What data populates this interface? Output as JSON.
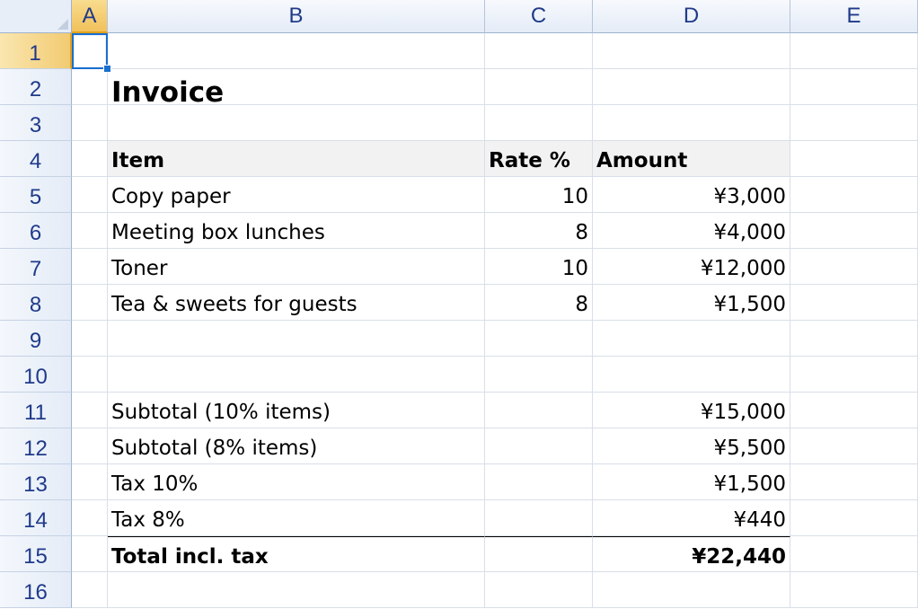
{
  "columns": [
    "A",
    "B",
    "C",
    "D",
    "E"
  ],
  "rows": [
    "1",
    "2",
    "3",
    "4",
    "5",
    "6",
    "7",
    "8",
    "9",
    "10",
    "11",
    "12",
    "13",
    "14",
    "15",
    "16"
  ],
  "invoice": {
    "title": "Invoice",
    "header": {
      "item": "Item",
      "rate": "Rate %",
      "amount": "Amount"
    },
    "lines": [
      {
        "item": "Copy paper",
        "rate": "10",
        "amount": "¥3,000"
      },
      {
        "item": "Meeting box lunches",
        "rate": "8",
        "amount": "¥4,000"
      },
      {
        "item": "Toner",
        "rate": "10",
        "amount": "¥12,000"
      },
      {
        "item": "Tea & sweets for guests",
        "rate": "8",
        "amount": "¥1,500"
      }
    ],
    "summary": [
      {
        "label": "Subtotal (10% items)",
        "value": "¥15,000"
      },
      {
        "label": "Subtotal (8% items)",
        "value": "¥5,500"
      },
      {
        "label": "Tax 10%",
        "value": "¥1,500"
      },
      {
        "label": "Tax 8%",
        "value": "¥440"
      }
    ],
    "total": {
      "label": "Total incl. tax",
      "value": "¥22,440"
    }
  },
  "selection": {
    "active_cell": "A1"
  },
  "colors": {
    "selected_header": "#f1c15b",
    "header_text": "#1f3a8a",
    "active_border": "#1a6fcf",
    "header_row_shade": "#f2f2f2"
  }
}
